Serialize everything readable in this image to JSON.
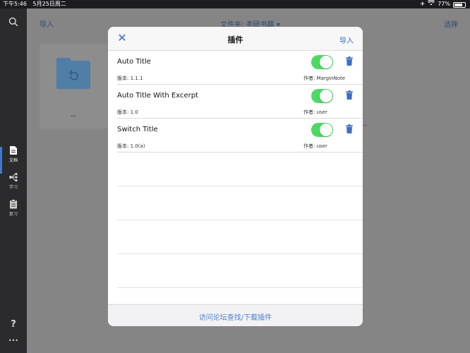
{
  "statusbar": {
    "time": "下午5:46",
    "date": "5月25日周二",
    "battery": "77%",
    "battery_level": 0.77
  },
  "sidebar": {
    "items": [
      {
        "label": "文档"
      },
      {
        "label": "学习"
      },
      {
        "label": "复习"
      }
    ],
    "help": "?",
    "more": "•••"
  },
  "background": {
    "import_label": "导入",
    "folder_label": "文件夹: 考研书籍 ▾",
    "select_label": "选择",
    "card_dots": "..",
    "extra_dots": ".."
  },
  "modal": {
    "close_icon": "✕",
    "title": "插件",
    "import_label": "导入",
    "plugins": [
      {
        "name": "Auto Title",
        "version": "版本: 1.1.1",
        "author": "作者: MarginNote",
        "enabled": true
      },
      {
        "name": "Auto Title With Excerpt",
        "version": "版本: 1.0",
        "author": "作者: user",
        "enabled": true
      },
      {
        "name": "Switch Title",
        "version": "版本: 1.0(a)",
        "author": "作者: user",
        "enabled": true
      }
    ],
    "footer_link": "访问论坛查找/下载插件"
  },
  "colors": {
    "accent": "#3b6fc4",
    "toggle_on": "#4cd964",
    "trash": "#3b6fc4"
  }
}
